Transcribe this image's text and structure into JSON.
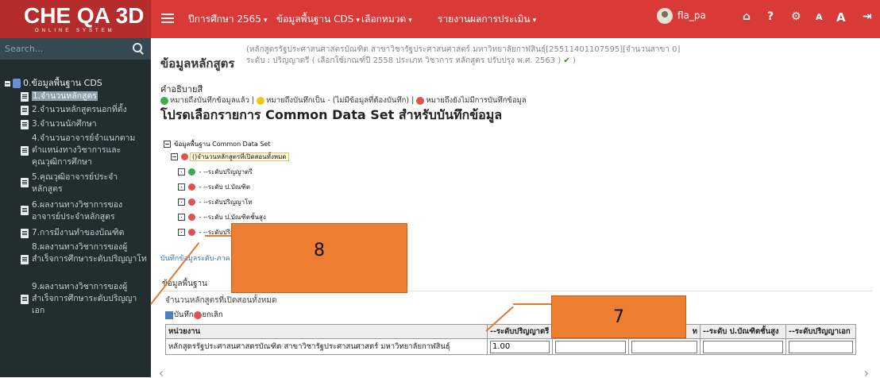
{
  "logo": {
    "main": "CHE QA 3D",
    "sub": "ONLINE SYSTEM"
  },
  "nav": {
    "items": [
      "ปีการศึกษา 2565",
      "ข้อมูลพื้นฐาน CDS",
      "เลือกหมวด",
      "รายงานผลการประเมิน"
    ],
    "caret": "▾"
  },
  "user": {
    "name": "fla_pa"
  },
  "top_icons": {
    "home": "⌂",
    "help": "?",
    "settings": "⚙",
    "font_small": "A",
    "font_large": "A",
    "logout": "⇥"
  },
  "search": {
    "placeholder": "Search..."
  },
  "sidebar": {
    "root": "0.ข้อมูลพื้นฐาน CDS",
    "items": [
      {
        "label": "1.จำนวนหลักสูตร"
      },
      {
        "label": "2.จำนวนหลักสูตรนอกที่ตั้ง"
      },
      {
        "label": "3.จำนวนนักศึกษา"
      },
      {
        "label": "4.จำนวนอาจารย์จำแนกตามตำแหน่งทางวิชาการและคุณวุฒิการศึกษา"
      },
      {
        "label": "5.คุณวุฒิอาจารย์ประจำหลักสูตร"
      },
      {
        "label": "6.ผลงานทางวิชาการของอาจารย์ประจำหลักสูตร"
      },
      {
        "label": "7.การมีงานทำของบัณฑิต"
      },
      {
        "label": "8.ผลงานทางวิชาการของผู้สำเร็จการศึกษาระดับปริญญาโท"
      },
      {
        "label": "9.ผลงานทางวิชาการของผู้สำเร็จการศึกษาระดับปริญญาเอก"
      }
    ]
  },
  "header": {
    "title": "ข้อมูลหลักสูตร",
    "sub_line1": "(หลักสูตรรัฐประศาสนศาสตรบัณฑิต สาขาวิชารัฐประศาสนศาสตร์ มหาวิทยาลัยกาฬสินธุ์[25511401107595][จำนวนสาขา 0]",
    "sub_line2": "ระดับ : ปริญญาตรี ( เลือกใช้เกณฑ์ปี 2558 ประเภท วิชาการ หลักสูตร ปรับปรุง พ.ศ. 2563 )",
    "check": "✔",
    "close_paren": ")"
  },
  "legend": {
    "title": "คำอธิบายสี",
    "green": "หมายถึงบันทึกข้อมูลแล้ว |",
    "yellow": "หมายถึงบันทึกเป็น - (ไม่มีข้อมูลที่ต้องบันทึก) |",
    "red": "หมายถึงยังไม่มีการบันทึกข้อมูล"
  },
  "section_title": "โปรดเลือกรายการ Common Data Set สำหรับบันทึกข้อมูล",
  "cds_tree": {
    "root": "ข้อมูลพื้นฐาน Common Data Set",
    "child": "()จำนวนหลักสูตรที่เปิดสอนทั้งหมด",
    "levels": [
      "- --ระดับปริญญาตรี",
      "- --ระดับ ป.บัณฑิต",
      "- --ระดับปริญญาโท",
      "- --ระดับ ป.บัณฑิตชั้นสูง",
      "- --ระดับปริญ"
    ]
  },
  "save_link": "บันทึกข้อมูลระดับ-ภาค",
  "panel": {
    "head": "ข้อมูลพื้นฐาน",
    "label": "จำนวนหลักสูตรที่เปิดสอนทั้งหมด",
    "save_btn": "บันทึก",
    "cancel_btn": "ยกเลิก"
  },
  "table": {
    "headers": [
      "หน่วยงาน",
      "--ระดับปริญญาตรี",
      "",
      "",
      "--ระดับ ป.บัณฑิตชั้นสูง",
      "--ระดับปริญญาเอก"
    ],
    "header_ghost": "ท",
    "row_name": "หลักสูตรรัฐประศาสนศาสตรบัณฑิต สาขาวิชารัฐประศาสนศาสตร์ มหาวิทยาลัยกาฬสินธุ์",
    "values": [
      "1.00",
      "",
      "",
      "",
      ""
    ]
  },
  "callouts": [
    "8",
    "7"
  ],
  "colors": {
    "topbar": "#d93a38",
    "sidebar": "#222d32",
    "callout": "#ed7d31"
  }
}
